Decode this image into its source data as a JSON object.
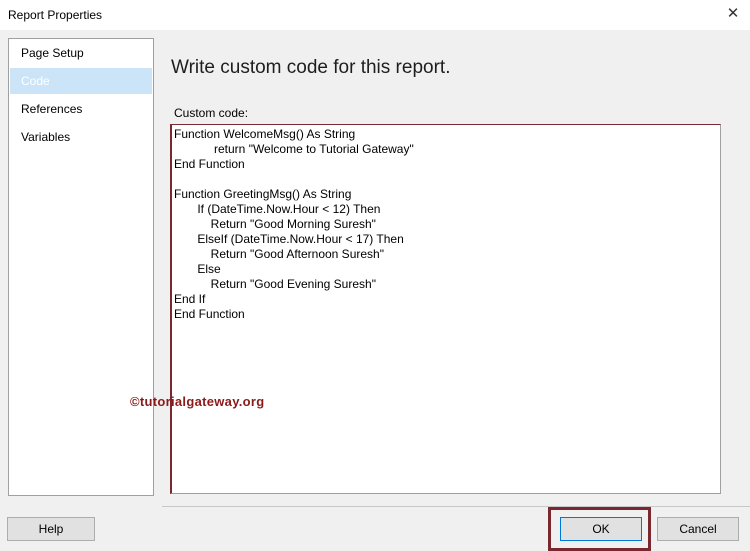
{
  "window": {
    "title": "Report Properties",
    "close_label": "✕"
  },
  "sidebar": {
    "items": [
      {
        "label": "Page Setup",
        "selected": false
      },
      {
        "label": "Code",
        "selected": true
      },
      {
        "label": "References",
        "selected": false
      },
      {
        "label": "Variables",
        "selected": false
      }
    ]
  },
  "main": {
    "heading": "Write custom code for this report.",
    "field_label": "Custom code:",
    "code_lines": [
      "Function WelcomeMsg() As String",
      "            return \"Welcome to Tutorial Gateway\"",
      "End Function",
      "",
      "Function GreetingMsg() As String",
      "       If (DateTime.Now.Hour < 12) Then",
      "           Return \"Good Morning Suresh\"",
      "       ElseIf (DateTime.Now.Hour < 17) Then",
      "           Return \"Good Afternoon Suresh\"",
      "       Else",
      "           Return \"Good Evening Suresh\"",
      "End If",
      "End Function"
    ]
  },
  "watermark": "©tutorialgateway.org",
  "buttons": {
    "help": "Help",
    "ok": "OK",
    "cancel": "Cancel"
  },
  "colors": {
    "selection": "#cce4f7",
    "highlight_border": "#7a2830",
    "accent": "#0078d7"
  }
}
